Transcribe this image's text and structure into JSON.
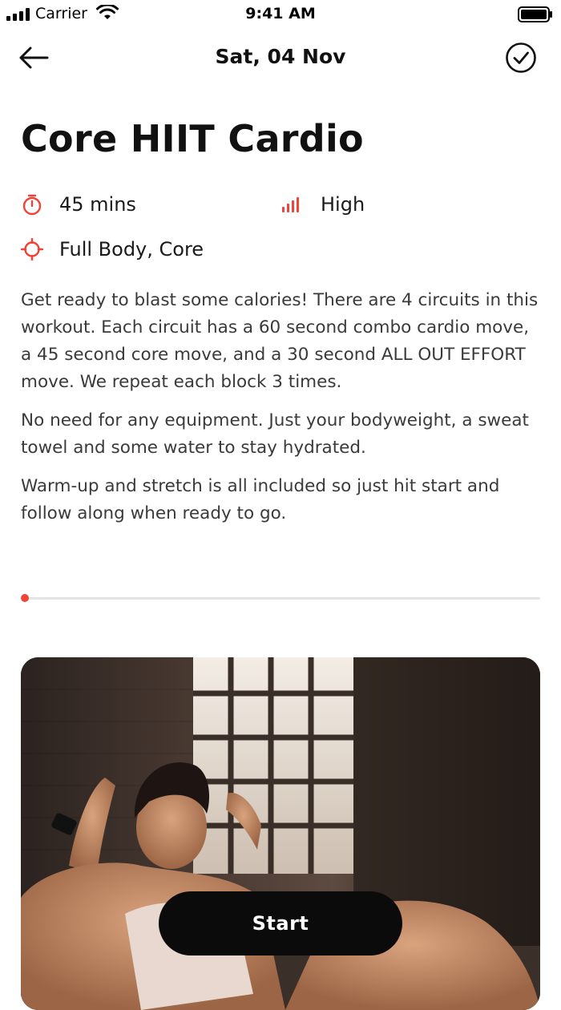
{
  "status_bar": {
    "carrier": "Carrier",
    "time": "9:41 AM"
  },
  "nav": {
    "date_title": "Sat, 04 Nov",
    "back_icon": "arrow-left-icon",
    "done_icon": "check-circle-icon"
  },
  "workout": {
    "title": "Core HIIT Cardio",
    "duration": "45 mins",
    "intensity": "High",
    "focus": "Full Body, Core",
    "description": [
      "Get ready to blast some calories!  There are 4 circuits in this workout.  Each circuit has a 60 second combo cardio move, a 45 second core move, and a 30 second ALL OUT EFFORT move.  We repeat each block 3 times.",
      "No need for any equipment. Just your bodyweight, a sweat towel and some water to stay hydrated.",
      "Warm-up and stretch is all included so just hit start and follow along when ready to go."
    ]
  },
  "progress": {
    "value": 0
  },
  "actions": {
    "start_label": "Start"
  },
  "colors": {
    "accent": "#f04438",
    "button_bg": "#0b0b0b",
    "text": "#111111",
    "body_text": "#3a3a3a"
  }
}
